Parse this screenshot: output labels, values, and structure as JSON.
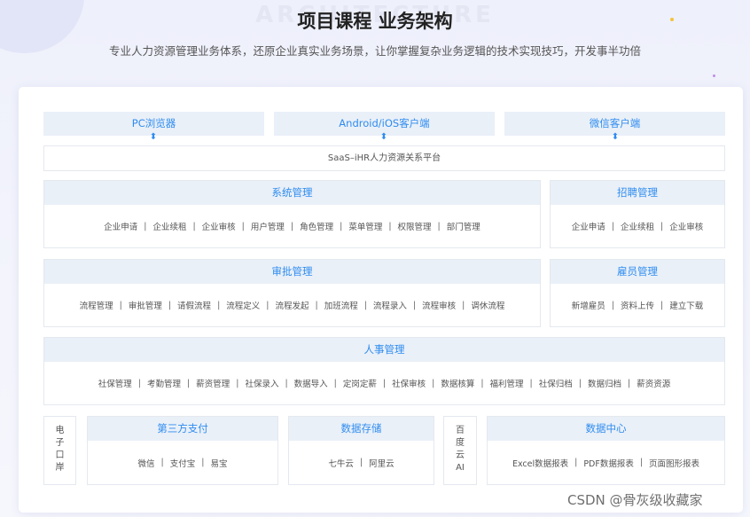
{
  "header": {
    "watermark": "ARCHITECTURE",
    "title": "项目课程 业务架构",
    "subtitle": "专业人力资源管理业务体系，还原企业真实业务场景，让你掌握复杂业务逻辑的技术实现技巧，开发事半功倍"
  },
  "clients": [
    "PC浏览器",
    "Android/iOS客户端",
    "微信客户端"
  ],
  "arrow_glyph": "⬍",
  "platform": "SaaS–iHR人力资源关系平台",
  "separator": "|",
  "modules": {
    "system": {
      "title": "系统管理",
      "items": [
        "企业申请",
        "企业续租",
        "企业审核",
        "用户管理",
        "角色管理",
        "菜单管理",
        "权限管理",
        "部门管理"
      ]
    },
    "recruit": {
      "title": "招聘管理",
      "items": [
        "企业申请",
        "企业续租",
        "企业审核"
      ]
    },
    "approval": {
      "title": "审批管理",
      "items": [
        "流程管理",
        "审批管理",
        "请假流程",
        "流程定义",
        "流程发起",
        "加班流程",
        "流程录入",
        "流程审核",
        "调休流程"
      ]
    },
    "employee": {
      "title": "雇员管理",
      "items": [
        "新增雇员",
        "资料上传",
        "建立下载"
      ]
    },
    "hr": {
      "title": "人事管理",
      "items": [
        "社保管理",
        "考勤管理",
        "薪资管理",
        "社保录入",
        "数据导入",
        "定岗定薪",
        "社保审核",
        "数据核算",
        "福利管理",
        "社保归档",
        "数据归档",
        "薪资资源"
      ]
    },
    "payment": {
      "title": "第三方支付",
      "items": [
        "微信",
        "支付宝",
        "易宝"
      ]
    },
    "storage": {
      "title": "数据存储",
      "items": [
        "七牛云",
        "阿里云"
      ]
    },
    "datacenter": {
      "title": "数据中心",
      "items": [
        "Excel数据报表",
        "PDF数据报表",
        "页面图形报表"
      ]
    }
  },
  "vertical_labels": {
    "esign": [
      "电",
      "子",
      "口",
      "岸"
    ],
    "baidu": [
      "百",
      "度",
      "云",
      "AI"
    ]
  },
  "source_watermark": "CSDN @骨灰级收藏家",
  "colors": {
    "accent": "#2e8cf0",
    "header_fill": "#eaf0f8",
    "border": "#e4e8ef",
    "background": "#eef0fb",
    "dot_yellow": "#f5c33b",
    "dot_purple": "#c08ce6"
  }
}
